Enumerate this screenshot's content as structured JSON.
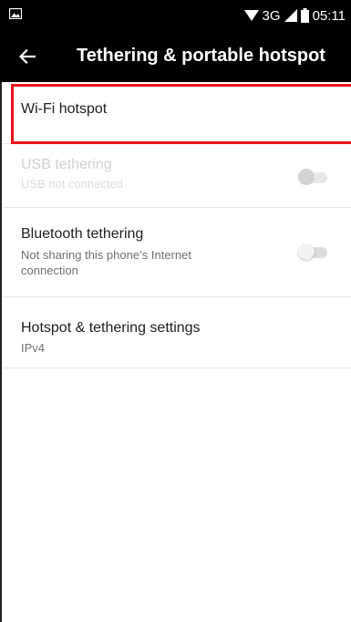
{
  "status_bar": {
    "network": "3G",
    "time": "05:11"
  },
  "app_bar": {
    "title": "Tethering & portable hotspot",
    "back_icon": "arrow-left-icon"
  },
  "items": [
    {
      "title": "Wi-Fi hotspot"
    },
    {
      "title": "USB tethering",
      "subtitle": "USB not connected",
      "enabled": false,
      "toggle_on": false
    },
    {
      "title": "Bluetooth tethering",
      "subtitle": "Not sharing this phone’s Internet connection",
      "enabled": true,
      "toggle_on": false
    },
    {
      "title": "Hotspot & tethering settings",
      "subtitle": "IPv4"
    }
  ],
  "colors": {
    "bar_background": "#000000",
    "highlight": "#e8141c",
    "page_background": "#ffffff"
  }
}
